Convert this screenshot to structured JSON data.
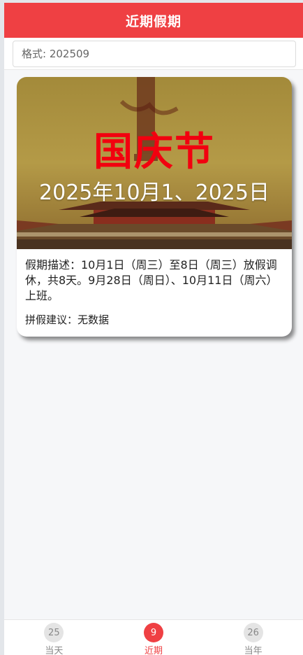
{
  "header": {
    "title": "近期假期"
  },
  "search": {
    "placeholder": "格式: 202509",
    "value": ""
  },
  "card": {
    "banner_title": "国庆节",
    "banner_date": "2025年10月1、2025日",
    "description": "假期描述：10月1日（周三）至8日（周三）放假调休，共8天。9月28日（周日）、10月11日（周六）上班。",
    "suggestion": "拼假建议：无数据"
  },
  "tabs": [
    {
      "badge": "25",
      "label": "当天",
      "active": false
    },
    {
      "badge": "9",
      "label": "近期",
      "active": true
    },
    {
      "badge": "26",
      "label": "当年",
      "active": false
    }
  ],
  "colors": {
    "accent": "#ef4043",
    "holiday_title": "#f2000f"
  }
}
